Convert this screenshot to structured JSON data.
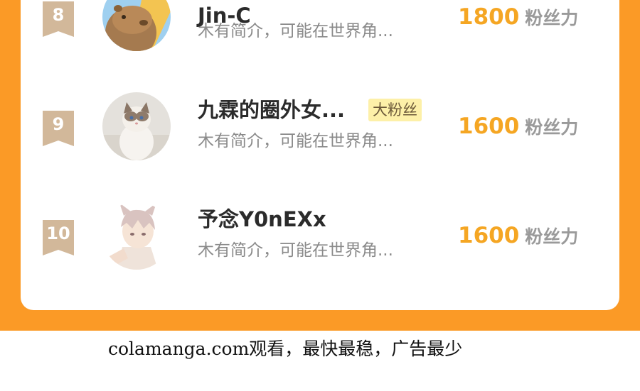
{
  "ranking": {
    "rows": [
      {
        "rank": "8",
        "name": "Jin-C",
        "tag": "",
        "desc": "木有简介，可能在世界角...",
        "power_value": "1800",
        "power_unit": "粉丝力",
        "avatar_icon": "capybara-avatar-icon"
      },
      {
        "rank": "9",
        "name": "九霖的圈外女...",
        "tag": "大粉丝",
        "desc": "木有简介，可能在世界角...",
        "power_value": "1600",
        "power_unit": "粉丝力",
        "avatar_icon": "ragdoll-cat-avatar-icon"
      },
      {
        "rank": "10",
        "name": "予念Y0nEXx",
        "tag": "",
        "desc": "木有简介，可能在世界角...",
        "power_value": "1600",
        "power_unit": "粉丝力",
        "avatar_icon": "anime-boy-avatar-icon"
      }
    ]
  },
  "footer": {
    "text": "colamanga.com观看，最快最稳，广告最少"
  },
  "colors": {
    "background_orange": "#fb9a26",
    "power_value": "#f5a623",
    "rank_badge": "#d2b89a",
    "tag_background": "#fdf0a8"
  }
}
